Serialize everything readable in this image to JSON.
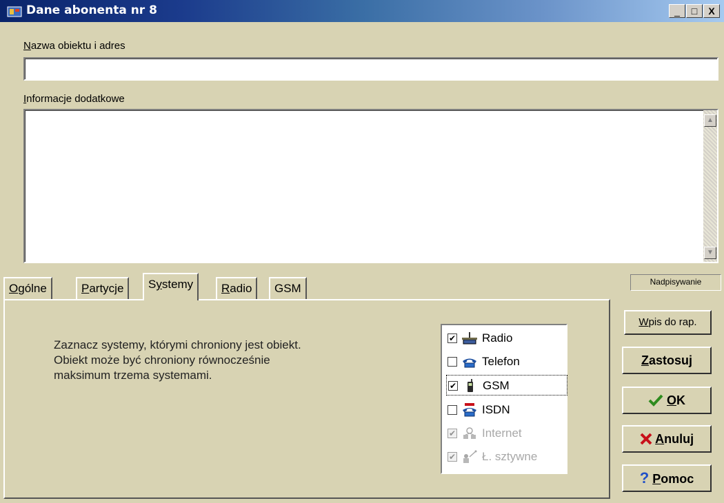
{
  "window": {
    "title": "Dane abonenta nr 8",
    "minimize": "_",
    "maximize": "□",
    "close": "X",
    "accent": "#0a246a"
  },
  "fields": {
    "name_label_u": "N",
    "name_label_rest": "azwa obiektu i adres",
    "name_value": "",
    "info_label_u": "I",
    "info_label_rest": "nformacje dodatkowe",
    "info_value": ""
  },
  "tabs": [
    {
      "u": "O",
      "rest": "gólne"
    },
    {
      "u": "P",
      "rest": "artycje"
    },
    {
      "pre": "S",
      "u": "y",
      "rest": "stemy"
    },
    {
      "u": "R",
      "rest": "adio"
    },
    {
      "pre": "",
      "u": "",
      "rest": "GSM"
    }
  ],
  "systems_panel": {
    "info_line1": "Zaznacz systemy, którymi chroniony jest obiekt.",
    "info_line2": "Obiekt może być chroniony równocześnie",
    "info_line3": "maksimum trzema systemami.",
    "items": [
      {
        "label": "Radio",
        "checked": "✔",
        "icon": "radio-antenna-icon"
      },
      {
        "label": "Telefon",
        "checked": "",
        "icon": "telephone-icon"
      },
      {
        "label": "GSM",
        "checked": "✔",
        "icon": "mobile-phone-icon"
      },
      {
        "label": "ISDN",
        "checked": "",
        "icon": "isdn-phone-icon"
      },
      {
        "label": "Internet",
        "checked": "✔",
        "icon": "internet-network-icon"
      },
      {
        "label": "Ł. sztywne",
        "checked": "✔",
        "icon": "leased-line-icon"
      }
    ]
  },
  "status": "Nadpisywanie",
  "buttons": {
    "report_u": "W",
    "report_rest": "pis do rap.",
    "apply_u": "Z",
    "apply_rest": "astosuj",
    "ok_u": "O",
    "ok_rest": "K",
    "cancel_u": "A",
    "cancel_rest": "nuluj",
    "help_u": "P",
    "help_rest": "omoc",
    "ok_icon_color": "#2e8b1e",
    "cancel_icon_color": "#c8101a",
    "help_icon_color": "#1f4fc8"
  }
}
